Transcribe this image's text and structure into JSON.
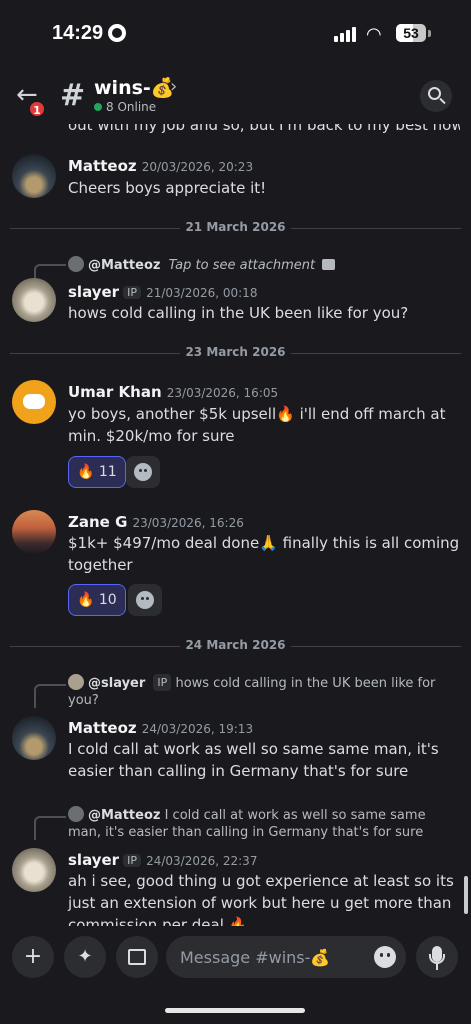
{
  "status_bar": {
    "time": "14:29",
    "battery": "53"
  },
  "header": {
    "unread_badge": "1",
    "channel_name": "wins-💰",
    "online_text": "8 Online"
  },
  "partial_top_text": "out with my job and so, but I'm back to my best now",
  "messages": [
    {
      "author": "Matteoz",
      "timestamp": "20/03/2026, 20:23",
      "text": "Cheers boys appreciate it!"
    },
    {
      "divider": "21 March 2026"
    },
    {
      "reply_to": "@Matteoz",
      "reply_text": "Tap to see attachment",
      "author": "slayer",
      "tag": "IP",
      "timestamp": "21/03/2026, 00:18",
      "text": "hows cold calling in the UK been like for you?"
    },
    {
      "divider": "23 March 2026"
    },
    {
      "author": "Umar Khan",
      "timestamp": "23/03/2026, 16:05",
      "text": "yo boys, another $5k upsell🔥 i'll end off march at min. $20k/mo for sure",
      "reaction_emoji": "🔥",
      "reaction_count": "11"
    },
    {
      "author": "Zane G",
      "timestamp": "23/03/2026, 16:26",
      "text": "$1k+ $497/mo deal done🙏 finally this is all coming together",
      "reaction_emoji": "🔥",
      "reaction_count": "10"
    },
    {
      "divider": "24 March 2026"
    },
    {
      "reply_to": "@slayer",
      "reply_tag": "IP",
      "reply_text": "hows cold calling in the UK been like for you?",
      "author": "Matteoz",
      "timestamp": "24/03/2026, 19:13",
      "text": "I cold call at work as well so same same man, it's easier than calling in Germany that's for sure"
    },
    {
      "reply_to": "@Matteoz",
      "reply_text": "I cold call at work as well so same same man, it's easier than calling in Germany that's for sure",
      "author": "slayer",
      "tag": "IP",
      "timestamp": "24/03/2026, 22:37",
      "text": "ah i see, good thing u got experience at least so its just an extension of work but here u get more than commission per deal 🔥"
    }
  ],
  "composer": {
    "placeholder": "Message #wins-💰"
  },
  "colors": {
    "accent": "#5865f2",
    "online": "#23a55a",
    "badge": "#e13a3a"
  }
}
